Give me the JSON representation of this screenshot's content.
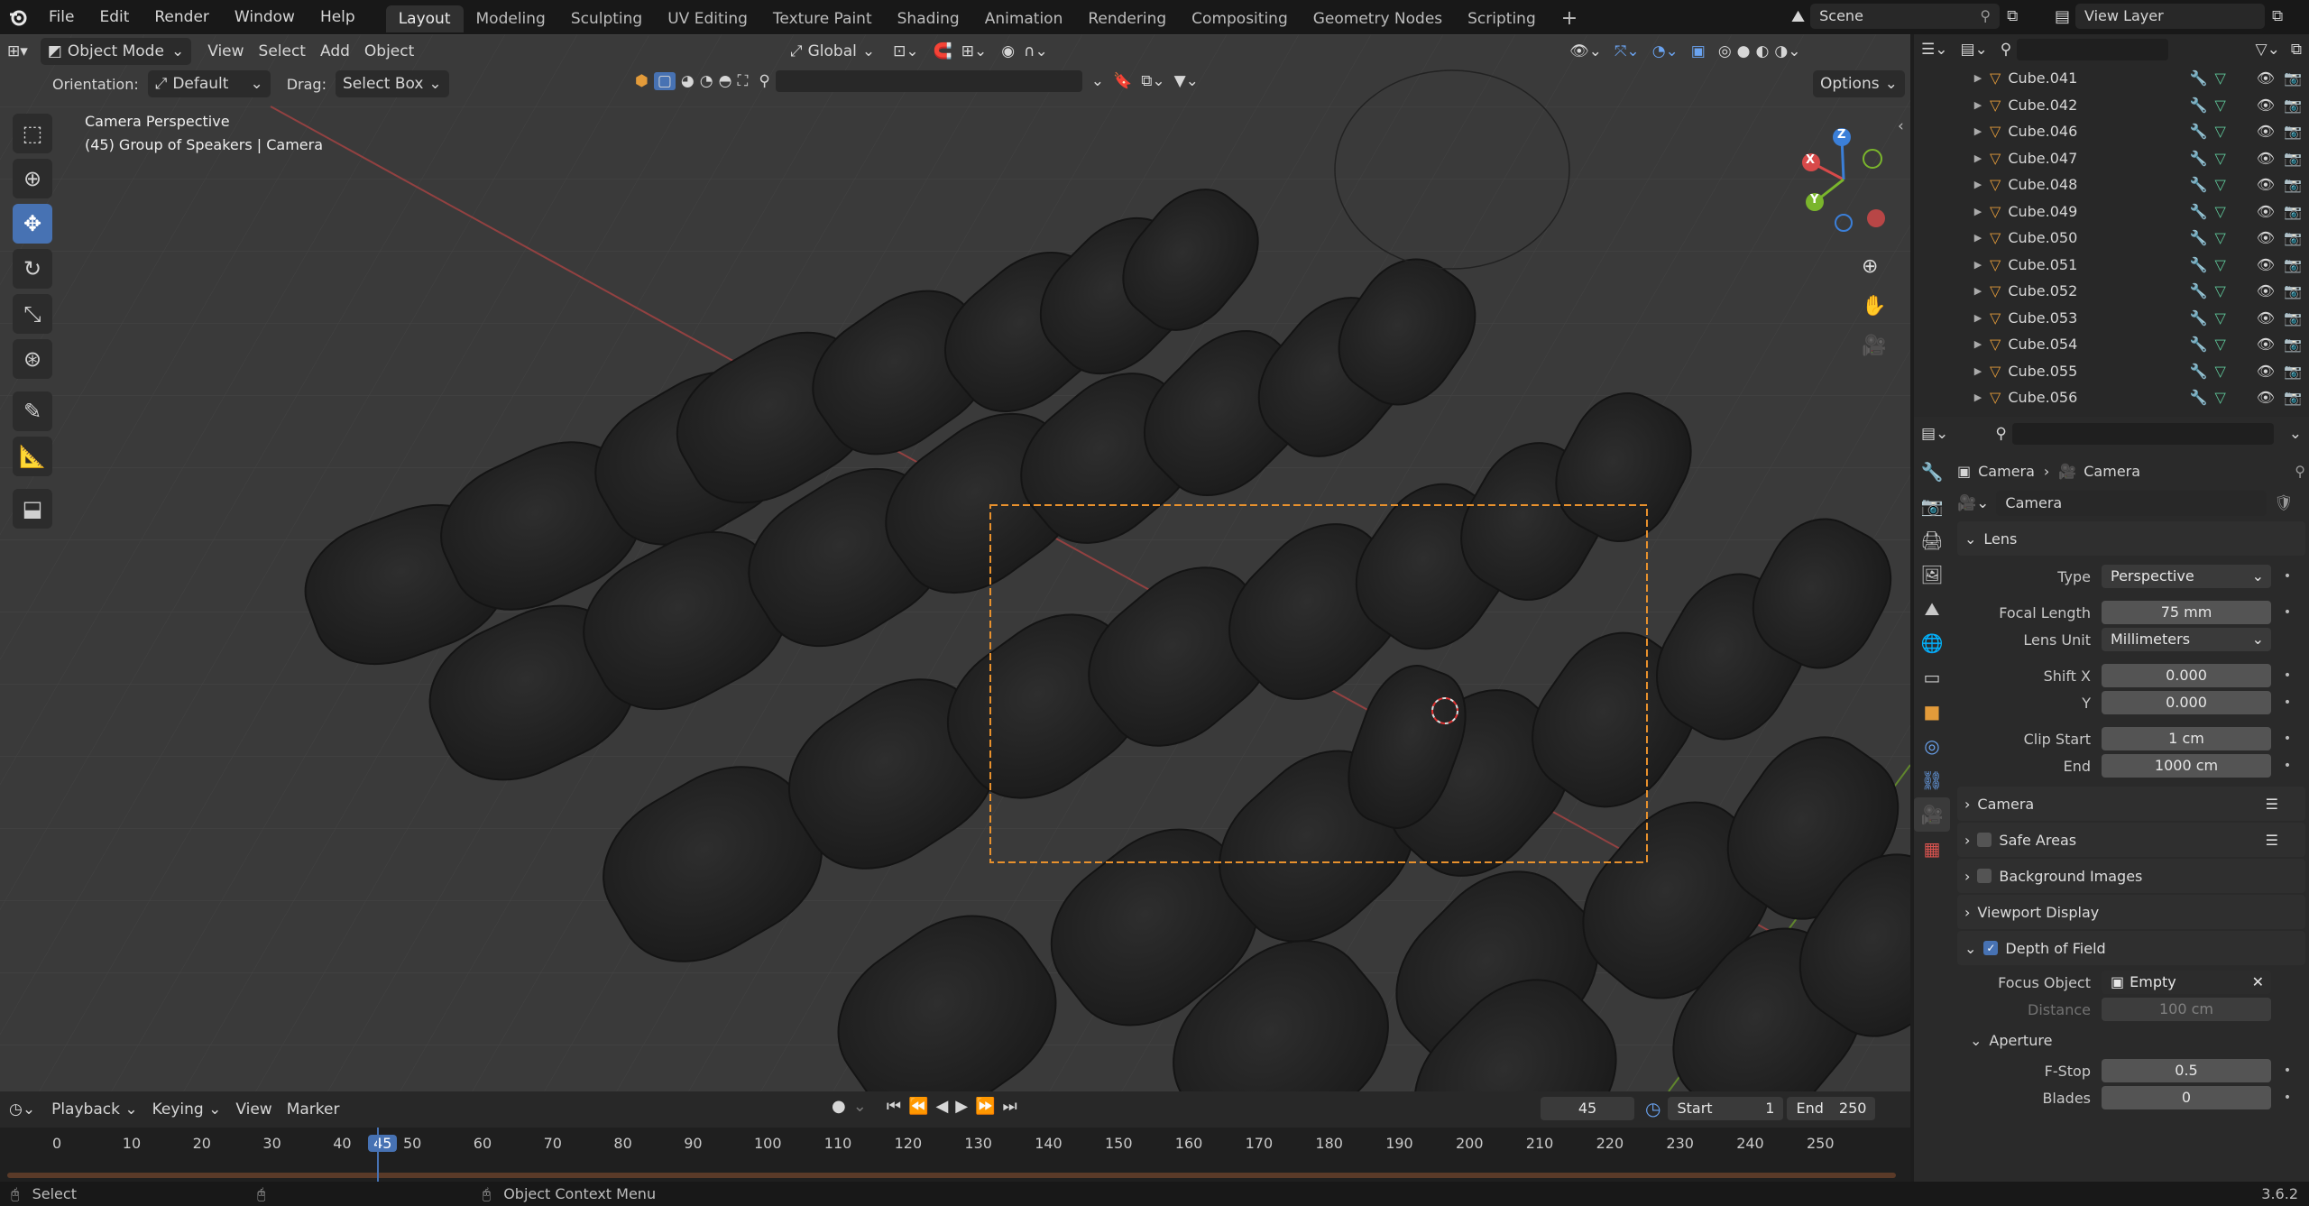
{
  "menu": [
    "File",
    "Edit",
    "Render",
    "Window",
    "Help"
  ],
  "workspaces": [
    "Layout",
    "Modeling",
    "Sculpting",
    "UV Editing",
    "Texture Paint",
    "Shading",
    "Animation",
    "Rendering",
    "Compositing",
    "Geometry Nodes",
    "Scripting"
  ],
  "active_workspace": "Layout",
  "scene": "Scene",
  "view_layer": "View Layer",
  "viewport_header": {
    "mode": "Object Mode",
    "menus": [
      "View",
      "Select",
      "Add",
      "Object"
    ],
    "transform": "Global",
    "orientation_label": "Orientation:",
    "orientation_value": "Default",
    "drag_label": "Drag:",
    "drag_value": "Select Box",
    "options": "Options"
  },
  "viewport_overlay": {
    "line1": "Camera Perspective",
    "line2": "(45) Group of Speakers | Camera"
  },
  "gizmo": {
    "x": "X",
    "y": "Y",
    "z": "Z"
  },
  "outliner": {
    "items": [
      "Cube.041",
      "Cube.042",
      "Cube.046",
      "Cube.047",
      "Cube.048",
      "Cube.049",
      "Cube.050",
      "Cube.051",
      "Cube.052",
      "Cube.053",
      "Cube.054",
      "Cube.055",
      "Cube.056"
    ]
  },
  "properties": {
    "breadcrumb_1": "Camera",
    "breadcrumb_2": "Camera",
    "datablock": "Camera",
    "lens": {
      "title": "Lens",
      "type_label": "Type",
      "type_value": "Perspective",
      "focal_label": "Focal Length",
      "focal_value": "75 mm",
      "unit_label": "Lens Unit",
      "unit_value": "Millimeters",
      "shiftx_label": "Shift X",
      "shiftx_value": "0.000",
      "shifty_label": "Y",
      "shifty_value": "0.000",
      "clipstart_label": "Clip Start",
      "clipstart_value": "1 cm",
      "clipend_label": "End",
      "clipend_value": "1000 cm"
    },
    "panels": [
      "Camera",
      "Safe Areas",
      "Background Images",
      "Viewport Display"
    ],
    "dof": {
      "title": "Depth of Field",
      "focus_label": "Focus Object",
      "focus_value": "Empty",
      "distance_label": "Distance",
      "distance_value": "100 cm",
      "aperture_title": "Aperture",
      "fstop_label": "F-Stop",
      "fstop_value": "0.5",
      "blades_label": "Blades",
      "blades_value": "0"
    }
  },
  "timeline": {
    "menus": [
      "Playback",
      "Keying",
      "View",
      "Marker"
    ],
    "current_frame": "45",
    "start_label": "Start",
    "start_value": "1",
    "end_label": "End",
    "end_value": "250",
    "ticks": [
      "0",
      "10",
      "20",
      "30",
      "40",
      "45",
      "50",
      "60",
      "70",
      "80",
      "90",
      "100",
      "110",
      "120",
      "130",
      "140",
      "150",
      "160",
      "170",
      "180",
      "190",
      "200",
      "210",
      "220",
      "230",
      "240",
      "250"
    ]
  },
  "status": {
    "left": "Select",
    "middle": "Object Context Menu",
    "version": "3.6.2"
  },
  "colors": {
    "accent": "#4772b3",
    "selection_outline": "#e8912d",
    "x_axis": "#d84a4a",
    "y_axis": "#7ab52c",
    "z_axis": "#3b7fd8"
  }
}
